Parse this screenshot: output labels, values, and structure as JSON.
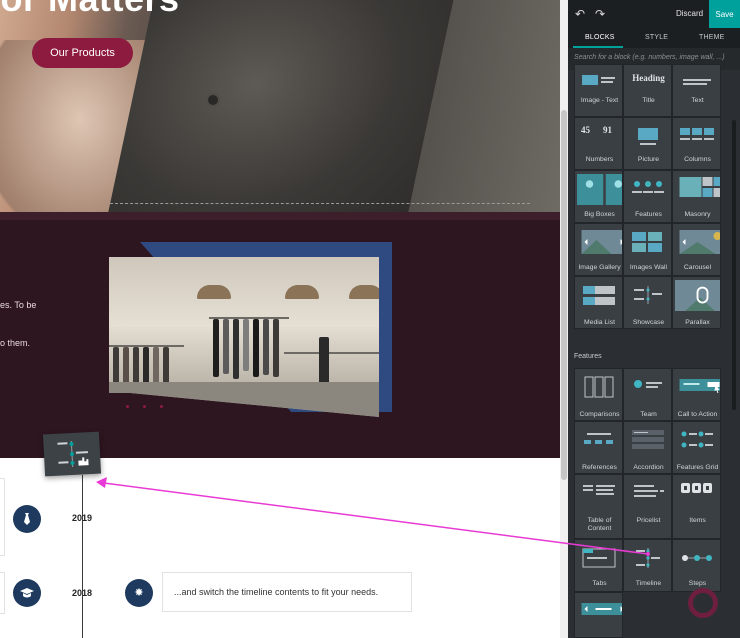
{
  "hero": {
    "title": "lor Matters",
    "button_label": "Our Products"
  },
  "dark_section": {
    "text_line_1": "es. To be",
    "text_line_2": "o them."
  },
  "timeline": {
    "rows": [
      {
        "year": "2019",
        "icon": "tie-icon"
      },
      {
        "year": "2018",
        "icon": "graduation-cap-icon",
        "second_icon": "star-icon",
        "text": "...and switch the timeline contents to fit your needs."
      }
    ]
  },
  "editor": {
    "topbar": {
      "undo_icon": "undo-icon",
      "redo_icon": "redo-icon",
      "discard_label": "Discard",
      "save_label": "Save"
    },
    "tabs": [
      {
        "label": "BLOCKS",
        "active": true
      },
      {
        "label": "STYLE",
        "active": false
      },
      {
        "label": "THEME",
        "active": false
      }
    ],
    "search_placeholder": "Search for a block (e.g. numbers, image wall, ...)",
    "blocks": [
      {
        "label": "Image - Text",
        "icon": "image-text-icon"
      },
      {
        "label": "Title",
        "icon": "heading-icon",
        "thumb_text": "Heading"
      },
      {
        "label": "Text",
        "icon": "text-icon"
      },
      {
        "label": "Numbers",
        "icon": "numbers-icon",
        "thumb_text_a": "45",
        "thumb_text_b": "91"
      },
      {
        "label": "Picture",
        "icon": "picture-icon"
      },
      {
        "label": "Columns",
        "icon": "columns-icon"
      },
      {
        "label": "Big Boxes",
        "icon": "big-boxes-icon"
      },
      {
        "label": "Features",
        "icon": "features-icon"
      },
      {
        "label": "Masonry",
        "icon": "masonry-icon"
      },
      {
        "label": "Image Gallery",
        "icon": "image-gallery-icon"
      },
      {
        "label": "Images Wall",
        "icon": "images-wall-icon"
      },
      {
        "label": "Carousel",
        "icon": "carousel-icon"
      },
      {
        "label": "Media List",
        "icon": "media-list-icon"
      },
      {
        "label": "Showcase",
        "icon": "showcase-icon"
      },
      {
        "label": "Parallax",
        "icon": "parallax-icon"
      }
    ],
    "features_title": "Features",
    "feature_blocks": [
      {
        "label": "Comparisons",
        "icon": "comparisons-icon"
      },
      {
        "label": "Team",
        "icon": "team-icon"
      },
      {
        "label": "Call to Action",
        "icon": "call-to-action-icon"
      },
      {
        "label": "References",
        "icon": "references-icon"
      },
      {
        "label": "Accordion",
        "icon": "accordion-icon"
      },
      {
        "label": "Features Grid",
        "icon": "features-grid-icon"
      },
      {
        "label": "Table of Content",
        "icon": "table-of-content-icon"
      },
      {
        "label": "Pricelist",
        "icon": "pricelist-icon"
      },
      {
        "label": "Items",
        "icon": "items-icon"
      },
      {
        "label": "Tabs",
        "icon": "tabs-icon"
      },
      {
        "label": "Timeline",
        "icon": "timeline-icon"
      },
      {
        "label": "Steps",
        "icon": "steps-icon"
      }
    ]
  },
  "colors": {
    "accent_teal": "#00a09d",
    "brand_burgundy": "#8d1a3f",
    "arrow_magenta": "#e83ad4",
    "timeline_navy": "#1e3a5f",
    "panel_bg": "#2b2f33"
  }
}
